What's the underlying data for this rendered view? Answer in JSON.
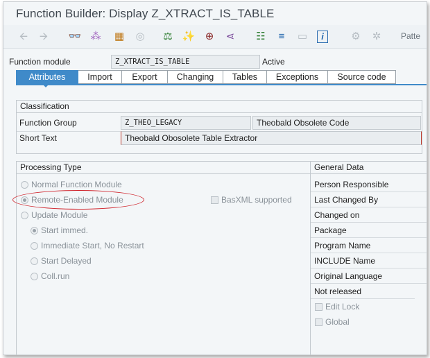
{
  "window": {
    "title": "Function Builder: Display Z_XTRACT_IS_TABLE"
  },
  "toolbar": {
    "buttons": [
      {
        "name": "back-arrow-icon",
        "glyph": "🡨",
        "enabled": false
      },
      {
        "name": "forward-arrow-icon",
        "glyph": "🡪",
        "enabled": false
      },
      {
        "name": "glasses-icon",
        "glyph": "👓",
        "enabled": true
      },
      {
        "name": "network-icon",
        "glyph": "⁂",
        "enabled": true
      },
      {
        "name": "object-stack-icon",
        "glyph": "▦",
        "enabled": true
      },
      {
        "name": "ring-icon",
        "glyph": "◎",
        "enabled": false
      },
      {
        "name": "object-hierarchy-icon",
        "glyph": "⚖",
        "enabled": true
      },
      {
        "name": "magic-wand-icon",
        "glyph": "✨",
        "enabled": true
      },
      {
        "name": "where-used-icon",
        "glyph": "⊕",
        "enabled": true
      },
      {
        "name": "branch-icon",
        "glyph": "⋖",
        "enabled": true
      },
      {
        "name": "hierarchy-icon",
        "glyph": "☷",
        "enabled": true
      },
      {
        "name": "stack-icon",
        "glyph": "≡",
        "enabled": true
      },
      {
        "name": "layout-icon",
        "glyph": "▭",
        "enabled": false
      },
      {
        "name": "info-icon",
        "glyph": "i",
        "enabled": true
      },
      {
        "name": "debug-icon",
        "glyph": "⚙",
        "enabled": false
      },
      {
        "name": "settings-icon",
        "glyph": "✲",
        "enabled": false
      }
    ],
    "pattern_label": "Patte"
  },
  "header": {
    "function_module_label": "Function module",
    "function_module_value": "Z_XTRACT_IS_TABLE",
    "status": "Active"
  },
  "tabs": [
    {
      "name": "tab-attributes",
      "label": "Attributes",
      "active": true
    },
    {
      "name": "tab-import",
      "label": "Import",
      "active": false
    },
    {
      "name": "tab-export",
      "label": "Export",
      "active": false
    },
    {
      "name": "tab-changing",
      "label": "Changing",
      "active": false
    },
    {
      "name": "tab-tables",
      "label": "Tables",
      "active": false
    },
    {
      "name": "tab-exceptions",
      "label": "Exceptions",
      "active": false
    },
    {
      "name": "tab-source-code",
      "label": "Source code",
      "active": false
    }
  ],
  "classification": {
    "title": "Classification",
    "function_group_label": "Function Group",
    "function_group_value": "Z_THEO_LEGACY",
    "function_group_desc": "Theobald Obsolete Code",
    "short_text_label": "Short Text",
    "short_text_value": "Theobald Obosolete Table Extractor"
  },
  "processing_type": {
    "title": "Processing Type",
    "options": [
      {
        "label": "Normal Function Module",
        "checked": false
      },
      {
        "label": "Remote-Enabled Module",
        "checked": true
      },
      {
        "label": "Update Module",
        "checked": false
      }
    ],
    "update_options": [
      {
        "label": "Start immed.",
        "checked": true
      },
      {
        "label": "Immediate Start, No Restart",
        "checked": false
      },
      {
        "label": "Start Delayed",
        "checked": false
      },
      {
        "label": "Coll.run",
        "checked": false
      }
    ],
    "basxml_label": "BasXML supported"
  },
  "general_data": {
    "title": "General Data",
    "items": [
      "Person Responsible",
      "Last Changed By",
      "Changed on",
      "Package",
      "Program Name",
      "INCLUDE Name",
      "Original Language",
      "Not released"
    ],
    "edit_lock_label": "Edit Lock",
    "global_label": "Global"
  },
  "colors": {
    "accent": "#3f8ac9",
    "highlight_ellipse": "#d0242c"
  }
}
